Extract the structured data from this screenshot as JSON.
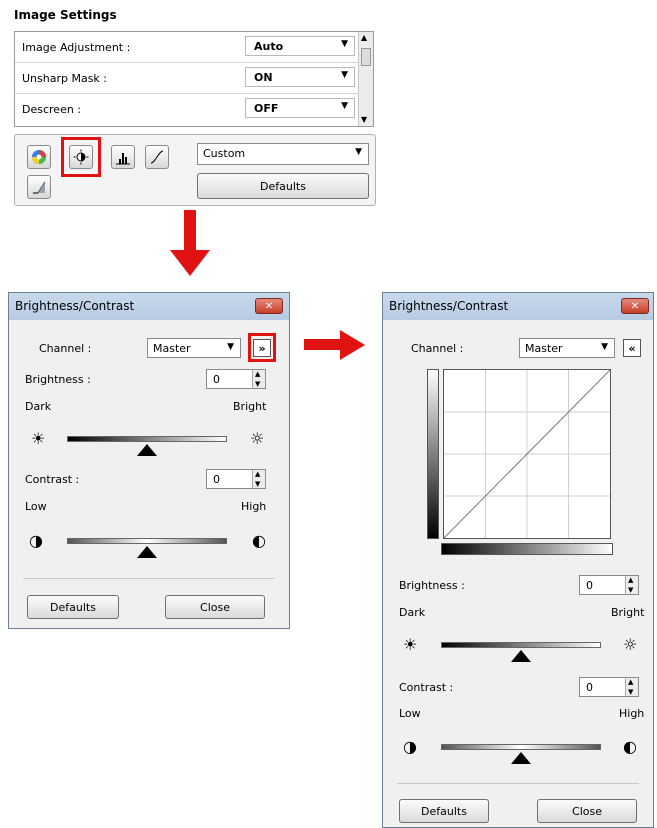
{
  "image_settings": {
    "title": "Image Settings",
    "rows": [
      {
        "label": "Image Adjustment :",
        "value": "Auto"
      },
      {
        "label": "Unsharp Mask :",
        "value": "ON"
      },
      {
        "label": "Descreen :",
        "value": "OFF"
      }
    ],
    "tools": {
      "preset_value": "Custom",
      "defaults_label": "Defaults",
      "icons": [
        "color-wheel-icon",
        "brightness-contrast-icon",
        "histogram-icon",
        "tone-curve-icon",
        "threshold-icon"
      ]
    }
  },
  "dialog_collapsed": {
    "title": "Brightness/Contrast",
    "close_glyph": "✕",
    "channel_label": "Channel :",
    "channel_value": "Master",
    "expand_glyph": "»",
    "brightness_label": "Brightness :",
    "brightness_value": "0",
    "dark_label": "Dark",
    "bright_label": "Bright",
    "contrast_label": "Contrast :",
    "contrast_value": "0",
    "low_label": "Low",
    "high_label": "High",
    "defaults_label": "Defaults",
    "close_label": "Close",
    "brightness_level": 0.5,
    "contrast_level": 0.5
  },
  "dialog_expanded": {
    "title": "Brightness/Contrast",
    "close_glyph": "✕",
    "channel_label": "Channel :",
    "channel_value": "Master",
    "collapse_glyph": "«",
    "brightness_label": "Brightness :",
    "brightness_value": "0",
    "dark_label": "Dark",
    "bright_label": "Bright",
    "contrast_label": "Contrast :",
    "contrast_value": "0",
    "low_label": "Low",
    "high_label": "High",
    "defaults_label": "Defaults",
    "close_label": "Close",
    "brightness_level": 0.5,
    "contrast_level": 0.5
  },
  "colors": {
    "highlight": "#e01212",
    "title_bar": "#b7cbe3",
    "dialog_bg": "#f0f0f0"
  }
}
